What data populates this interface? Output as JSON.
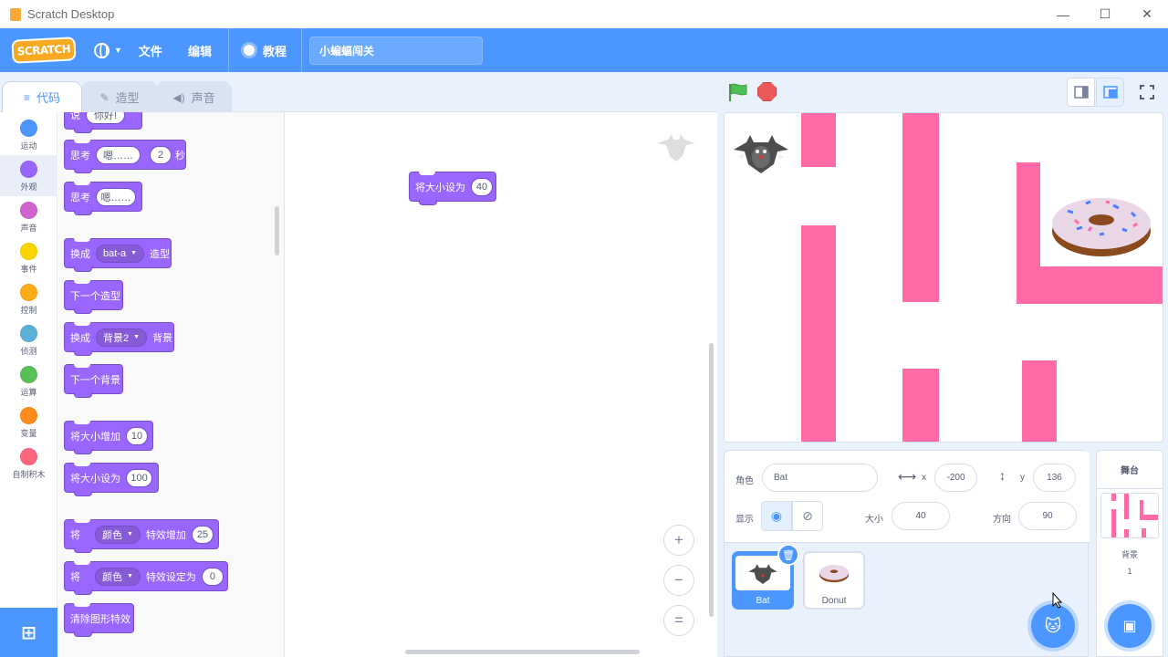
{
  "window": {
    "title": "Scratch Desktop",
    "minimize": "—",
    "maximize": "☐",
    "close": "✕"
  },
  "menubar": {
    "logo": "SCRATCH",
    "file": "文件",
    "edit": "编辑",
    "tutorials": "教程",
    "project_title": "小蝙蝠闯关"
  },
  "tabs": [
    {
      "label": "代码",
      "icon": "code-icon",
      "active": true
    },
    {
      "label": "造型",
      "icon": "brush-icon",
      "active": false
    },
    {
      "label": "声音",
      "icon": "speaker-icon",
      "active": false
    }
  ],
  "categories": [
    {
      "label": "运动",
      "color": "#4c97ff"
    },
    {
      "label": "外观",
      "color": "#9966ff",
      "selected": true
    },
    {
      "label": "声音",
      "color": "#cf63cf"
    },
    {
      "label": "事件",
      "color": "#ffd500"
    },
    {
      "label": "控制",
      "color": "#ffab19"
    },
    {
      "label": "侦测",
      "color": "#5cb1d6"
    },
    {
      "label": "运算",
      "color": "#59c059"
    },
    {
      "label": "变量",
      "color": "#ff8c1a"
    },
    {
      "label": "自制积木",
      "color": "#ff6680"
    }
  ],
  "palette": {
    "top_partial": {
      "a": "说",
      "b": "你好!"
    },
    "think_secs": {
      "a": "思考",
      "arg1": "嗯……",
      "arg2": "2",
      "b": "秒"
    },
    "think": {
      "a": "思考",
      "arg1": "嗯……"
    },
    "switch_costume": {
      "a": "换成",
      "dd": "bat-a",
      "b": "造型"
    },
    "next_costume": {
      "a": "下一个造型"
    },
    "switch_backdrop": {
      "a": "换成",
      "dd": "背景2",
      "b": "背景"
    },
    "next_backdrop": {
      "a": "下一个背景"
    },
    "change_size": {
      "a": "将大小增加",
      "arg": "10"
    },
    "set_size": {
      "a": "将大小设为",
      "arg": "100"
    },
    "change_effect": {
      "a": "将",
      "dd": "颜色",
      "b": "特效增加",
      "arg": "25"
    },
    "set_effect": {
      "a": "将",
      "dd": "颜色",
      "b": "特效设定为",
      "arg": "0"
    },
    "clear_effects": {
      "a": "清除图形特效"
    }
  },
  "workspace": {
    "block": {
      "a": "将大小设为",
      "arg": "40"
    },
    "zoom_in": "+",
    "zoom_out": "−",
    "zoom_reset": "="
  },
  "sprite_info": {
    "sprite_label": "角色",
    "sprite_name": "Bat",
    "x_label": "x",
    "x": "-200",
    "y_label": "y",
    "y": "136",
    "show_label": "显示",
    "size_label": "大小",
    "size": "40",
    "direction_label": "方向",
    "direction": "90"
  },
  "sprites": [
    {
      "name": "Bat",
      "selected": true
    },
    {
      "name": "Donut",
      "selected": false
    }
  ],
  "stage_pane": {
    "header": "舞台",
    "backdrops_label": "背景",
    "backdrops_count": "1"
  },
  "colors": {
    "accent": "#4c97ff",
    "looks": "#9966ff",
    "wall": "#ff6aa7"
  }
}
